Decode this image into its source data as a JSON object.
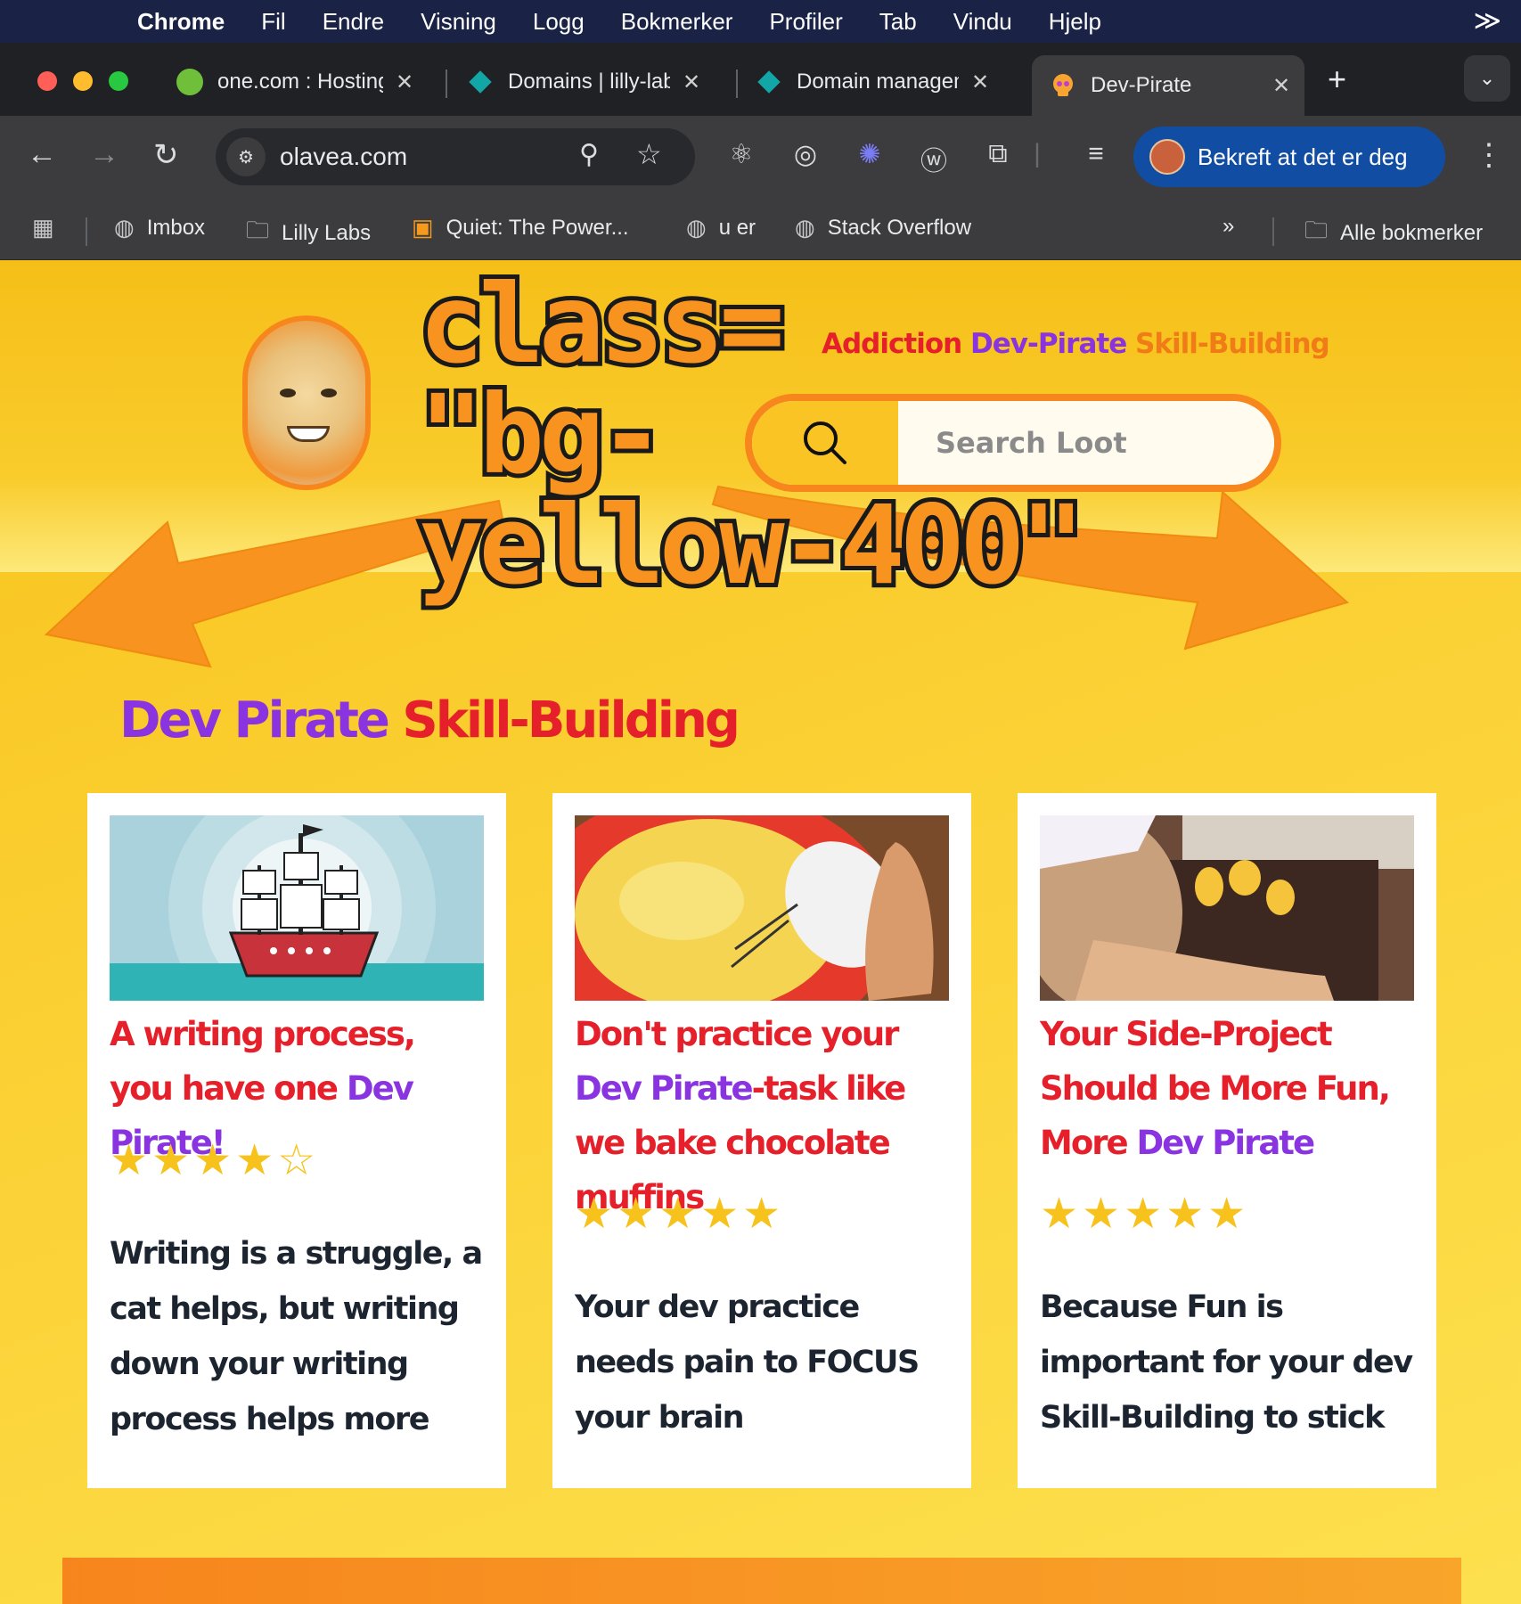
{
  "menubar": {
    "app": "Chrome",
    "items": [
      "Fil",
      "Endre",
      "Visning",
      "Logg",
      "Bokmerker",
      "Profiler",
      "Tab",
      "Vindu",
      "Hjelp"
    ]
  },
  "tabs": [
    {
      "title": "one.com : Hosting",
      "icon": "green-circle-icon"
    },
    {
      "title": "Domains | lilly-labs",
      "icon": "teal-diamond-icon"
    },
    {
      "title": "Domain management",
      "icon": "teal-diamond-icon"
    },
    {
      "title": "Dev-Pirate",
      "icon": "skull-icon",
      "active": true
    }
  ],
  "toolbar": {
    "url": "olavea.com",
    "profile_label": "Bekreft at det er deg"
  },
  "bookmarks": {
    "items": [
      "Imbox",
      "Lilly Labs",
      "Quiet: The Power...",
      "u er",
      "Stack Overflow"
    ],
    "all_label": "Alle bokmerker",
    "overflow": "»"
  },
  "page": {
    "annotation": "class=\n\"bg-\nyellow-400\"",
    "tagline": {
      "part1": "Addiction ",
      "part2": "Dev-Pirate ",
      "part3": "Skill-Building"
    },
    "search_placeholder": "Search Loot",
    "section_title": {
      "part1": "Dev Pirate ",
      "part2": "Skill-Building"
    },
    "cards": [
      {
        "title_pre": "A writing process, you have one ",
        "title_hl": "Dev Pirate!",
        "title_post": "",
        "stars": "★★★★☆",
        "rating": 4,
        "body": "Writing is a struggle, a cat helps, but writing down your writing process helps more"
      },
      {
        "title_pre": "Don't practice your ",
        "title_hl": "Dev Pirate",
        "title_post": "-task like we bake chocolate muffins",
        "stars": "★★★★★",
        "rating": 5,
        "body": "Your dev practice needs pain to FOCUS your brain"
      },
      {
        "title_pre": "Your Side-Project Should be More Fun, More ",
        "title_hl": "Dev Pirate",
        "title_post": "",
        "stars": "★★★★★",
        "rating": 5,
        "body": "Because Fun is important for your dev Skill-Building to stick"
      }
    ]
  },
  "colors": {
    "page_bg": "#fbd135",
    "accent_orange": "#f7861d",
    "title_red": "#e5202a",
    "title_purple": "#8a33e0",
    "star": "#f7c21b"
  }
}
